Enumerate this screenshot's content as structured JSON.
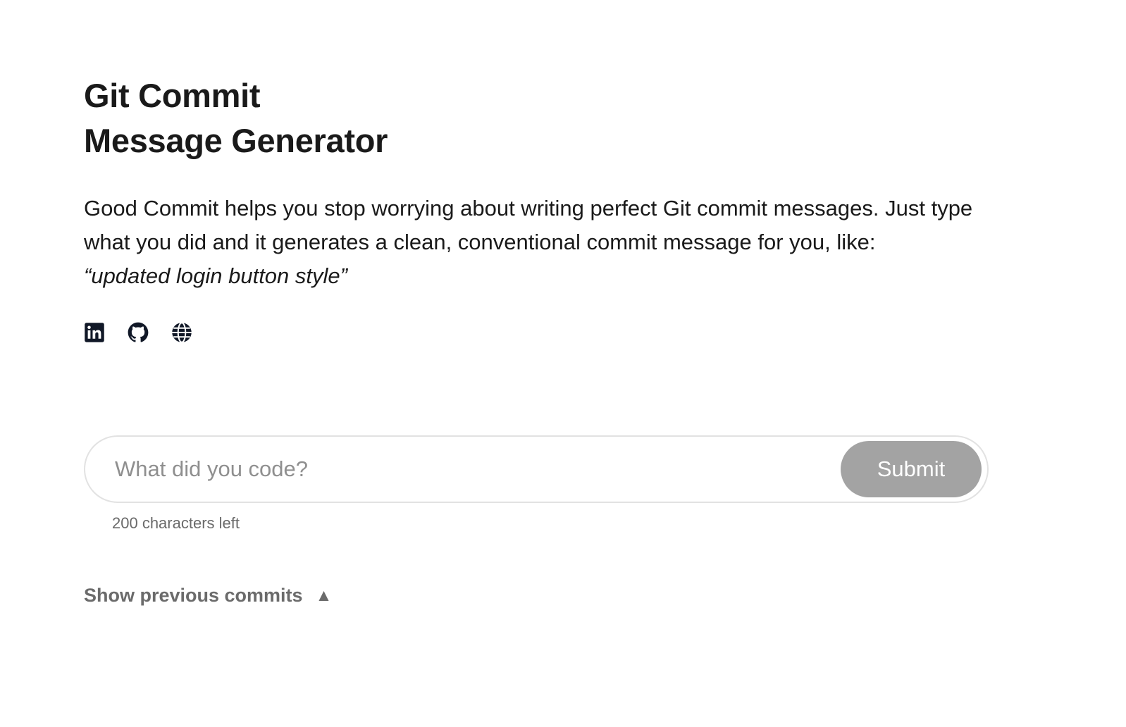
{
  "header": {
    "title_line1": "Git Commit",
    "title_line2": "Message Generator"
  },
  "description": {
    "text": "Good Commit helps you stop worrying about writing perfect Git commit messages. Just type what you did and it generates a clean, conventional commit message for you, like:",
    "example": "“updated login button style”"
  },
  "social": {
    "icons": [
      "linkedin-icon",
      "github-icon",
      "globe-icon"
    ]
  },
  "form": {
    "placeholder": "What did you code?",
    "value": "",
    "submit_label": "Submit",
    "chars_left": "200 characters left"
  },
  "history": {
    "toggle_label": "Show previous commits",
    "toggle_arrow": "▲"
  },
  "colors": {
    "text": "#1a1a1a",
    "submit_bg": "#a3a3a3",
    "muted": "#6b6b6b",
    "border": "#e2e2e2"
  }
}
